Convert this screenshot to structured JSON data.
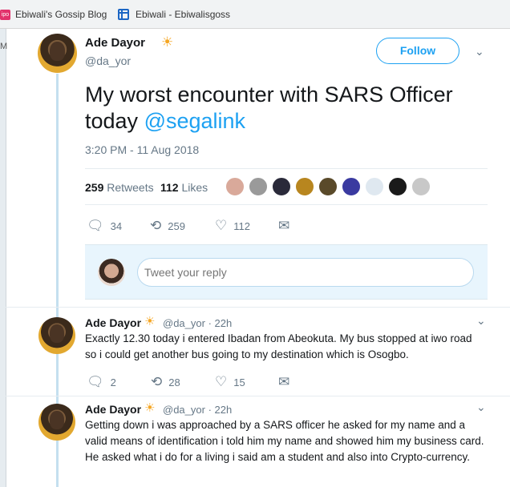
{
  "bookmarks": [
    {
      "icon": "ebiwali-favicon",
      "label": "Ebiwali's Gossip Blog"
    },
    {
      "icon": "blogger-favicon",
      "label": "Ebiwali - Ebiwalisgoss"
    }
  ],
  "left_strip_char": "M",
  "tweet": {
    "author": "Ade Dayor",
    "handle": "@da_yor",
    "follow_label": "Follow",
    "text_main": "My worst encounter with SARS Officer today ",
    "mention": "@segalink",
    "timestamp": "3:20 PM - 11 Aug 2018",
    "retweets_count": "259",
    "retweets_label": "Retweets",
    "likes_count": "112",
    "likes_label": "Likes",
    "actions": {
      "replies": "34",
      "retweets": "259",
      "likes": "112"
    },
    "reply_placeholder": "Tweet your reply"
  },
  "replies": [
    {
      "author": "Ade Dayor",
      "handle": "@da_yor",
      "time": "22h",
      "text": "Exactly 12.30 today i entered Ibadan from Abeokuta. My bus stopped at iwo road so i could get another bus going to my destination which is Osogbo.",
      "replies": "2",
      "retweets": "28",
      "likes": "15"
    },
    {
      "author": "Ade Dayor",
      "handle": "@da_yor",
      "time": "22h",
      "text": "Getting down i was approached by a SARS officer he asked for my name and a valid means of identification i told him my name and showed him my business card. He asked what i do for a living i said am a student and also into Crypto-currency."
    }
  ],
  "colors": {
    "accent": "#1da1f2",
    "muted": "#657786",
    "thread_line": "#c4dfef",
    "reply_bg": "#e8f5fd"
  }
}
